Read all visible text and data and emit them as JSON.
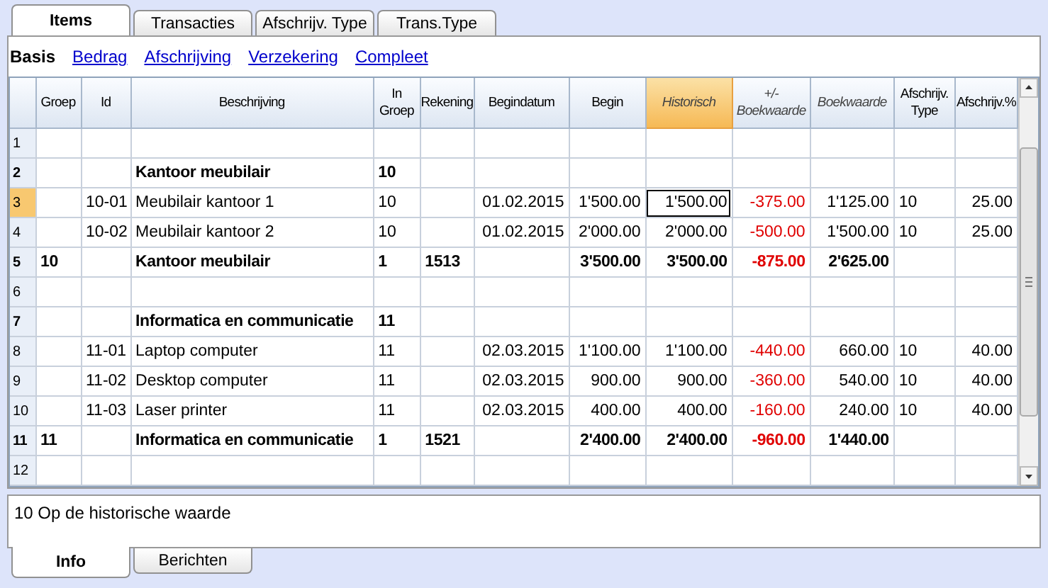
{
  "top_tabs": [
    {
      "label": "Items",
      "selected": true
    },
    {
      "label": "Transacties",
      "selected": false
    },
    {
      "label": "Afschrijv. Type",
      "selected": false
    },
    {
      "label": "Trans.Type",
      "selected": false
    }
  ],
  "views": [
    {
      "label": "Basis",
      "selected": true
    },
    {
      "label": "Bedrag",
      "selected": false
    },
    {
      "label": "Afschrijving",
      "selected": false
    },
    {
      "label": "Verzekering",
      "selected": false
    },
    {
      "label": "Compleet",
      "selected": false
    }
  ],
  "table": {
    "columns": [
      {
        "label": "Groep",
        "kind": "text",
        "calculated": false,
        "selected": false
      },
      {
        "label": "Id",
        "kind": "text",
        "calculated": false,
        "selected": false
      },
      {
        "label": "Beschrijving",
        "kind": "text",
        "calculated": false,
        "selected": false
      },
      {
        "label": "In\nGroep",
        "kind": "text",
        "calculated": false,
        "selected": false
      },
      {
        "label": "Rekening",
        "kind": "text",
        "calculated": false,
        "selected": false
      },
      {
        "label": "Begindatum",
        "kind": "number",
        "calculated": false,
        "selected": false
      },
      {
        "label": "Begin",
        "kind": "number",
        "calculated": false,
        "selected": false
      },
      {
        "label": "Historisch",
        "kind": "number",
        "calculated": true,
        "selected": true
      },
      {
        "label": "+/-\nBoekwaarde",
        "kind": "delta",
        "calculated": true,
        "selected": false
      },
      {
        "label": "Boekwaarde",
        "kind": "number",
        "calculated": true,
        "selected": false
      },
      {
        "label": "Afschrijv.\nType",
        "kind": "text",
        "calculated": false,
        "selected": false
      },
      {
        "label": "Afschrijv.%",
        "kind": "number",
        "calculated": false,
        "selected": false
      }
    ],
    "rows": [
      {
        "number": "1",
        "bold": false,
        "selected": false,
        "cells": [
          "",
          "",
          "",
          "",
          "",
          "",
          "",
          "",
          "",
          "",
          "",
          ""
        ]
      },
      {
        "number": "2",
        "bold": true,
        "selected": false,
        "cells": [
          "",
          "",
          "Kantoor meubilair",
          "10",
          "",
          "",
          "",
          "",
          "",
          "",
          "",
          ""
        ]
      },
      {
        "number": "3",
        "bold": false,
        "selected": true,
        "cells": [
          "",
          "10-01",
          "Meubilair kantoor 1",
          "10",
          "",
          "01.02.2015",
          "1'500.00",
          "1'500.00",
          "-375.00",
          "1'125.00",
          "10",
          "25.00"
        ]
      },
      {
        "number": "4",
        "bold": false,
        "selected": false,
        "cells": [
          "",
          "10-02",
          "Meubilair kantoor 2",
          "10",
          "",
          "01.02.2015",
          "2'000.00",
          "2'000.00",
          "-500.00",
          "1'500.00",
          "10",
          "25.00"
        ]
      },
      {
        "number": "5",
        "bold": true,
        "selected": false,
        "cells": [
          "10",
          "",
          "Kantoor meubilair",
          "1",
          "1513",
          "",
          "3'500.00",
          "3'500.00",
          "-875.00",
          "2'625.00",
          "",
          ""
        ]
      },
      {
        "number": "6",
        "bold": false,
        "selected": false,
        "cells": [
          "",
          "",
          "",
          "",
          "",
          "",
          "",
          "",
          "",
          "",
          "",
          ""
        ]
      },
      {
        "number": "7",
        "bold": true,
        "selected": false,
        "cells": [
          "",
          "",
          "Informatica en communicatie",
          "11",
          "",
          "",
          "",
          "",
          "",
          "",
          "",
          ""
        ]
      },
      {
        "number": "8",
        "bold": false,
        "selected": false,
        "cells": [
          "",
          "11-01",
          "Laptop computer",
          "11",
          "",
          "02.03.2015",
          "1'100.00",
          "1'100.00",
          "-440.00",
          "660.00",
          "10",
          "40.00"
        ]
      },
      {
        "number": "9",
        "bold": false,
        "selected": false,
        "cells": [
          "",
          "11-02",
          "Desktop computer",
          "11",
          "",
          "02.03.2015",
          "900.00",
          "900.00",
          "-360.00",
          "540.00",
          "10",
          "40.00"
        ]
      },
      {
        "number": "10",
        "bold": false,
        "selected": false,
        "cells": [
          "",
          "11-03",
          "Laser printer",
          "11",
          "",
          "02.03.2015",
          "400.00",
          "400.00",
          "-160.00",
          "240.00",
          "10",
          "40.00"
        ]
      },
      {
        "number": "11",
        "bold": true,
        "selected": false,
        "cells": [
          "11",
          "",
          "Informatica en communicatie",
          "1",
          "1521",
          "",
          "2'400.00",
          "2'400.00",
          "-960.00",
          "1'440.00",
          "",
          ""
        ]
      },
      {
        "number": "12",
        "bold": false,
        "selected": false,
        "cells": [
          "",
          "",
          "",
          "",
          "",
          "",
          "",
          "",
          "",
          "",
          "",
          ""
        ]
      }
    ]
  },
  "info": {
    "text": "10 Op de historische waarde"
  },
  "bottom_tabs": [
    {
      "label": "Info",
      "selected": true
    },
    {
      "label": "Berichten",
      "selected": false
    }
  ]
}
